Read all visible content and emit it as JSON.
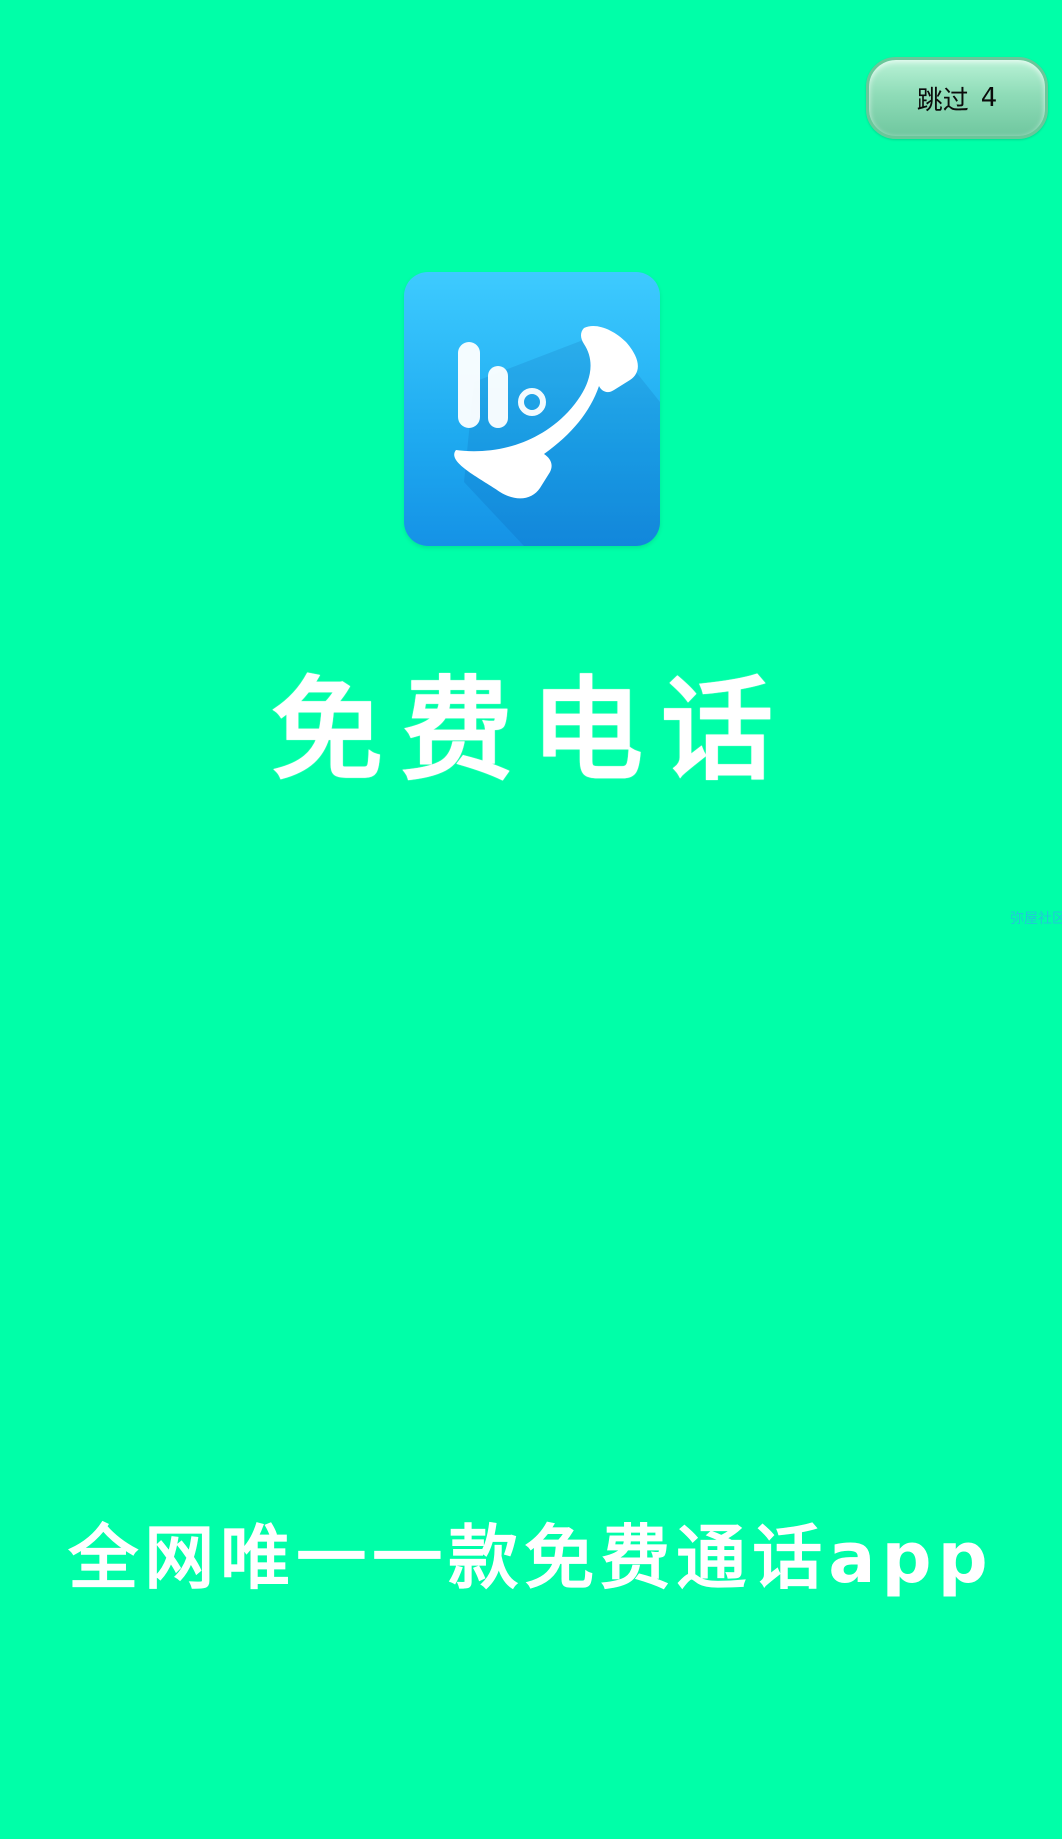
{
  "skip_button": {
    "label": "跳过",
    "countdown": "4"
  },
  "logo": {
    "icon": "phone-call-icon",
    "background_color": "#1EAAF0"
  },
  "title": "免费电话",
  "side_label": "弥屋社区",
  "slogan": "全网唯一一款免费通话app",
  "colors": {
    "background": "#00FFA8",
    "text": "#FFFFFF"
  }
}
